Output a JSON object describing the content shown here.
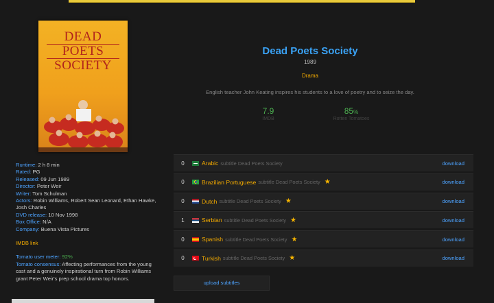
{
  "movie": {
    "title": "Dead Poets Society",
    "year": "1989",
    "genre": "Drama",
    "plot": "English teacher John Keating inspires his students to a love of poetry and to seize the day.",
    "poster_title_lines": [
      "DEAD",
      "POETS",
      "SOCIETY"
    ]
  },
  "scores": {
    "imdb": {
      "value": "7.9",
      "label": "IMDB"
    },
    "rt": {
      "value": "85",
      "unit": "%",
      "label": "Rotten Tomatoes"
    }
  },
  "info": {
    "runtime": {
      "key": "Runtime:",
      "value": "2 h 8 min"
    },
    "rated": {
      "key": "Rated:",
      "value": "PG"
    },
    "released": {
      "key": "Released:",
      "value": "09 Jun 1989"
    },
    "director": {
      "key": "Director:",
      "value": "Peter Weir"
    },
    "writer": {
      "key": "Writer:",
      "value": "Tom Schulman"
    },
    "actors": {
      "key": "Actors:",
      "value": "Robin Williams, Robert Sean Leonard, Ethan Hawke, Josh Charles"
    },
    "dvd": {
      "key": "DVD release:",
      "value": "10 Nov 1998"
    },
    "box_office": {
      "key": "Box Office:",
      "value": "N/A"
    },
    "company": {
      "key": "Company:",
      "value": "Buena Vista Pictures"
    },
    "imdb_link": "IMDB link",
    "tomato_meter": {
      "key": "Tomato user meter:",
      "value": "92%"
    },
    "tomato_consensus": {
      "key": "Tomato consensus:",
      "value": "Affecting performances from the young cast and a genuinely inspirational turn from Robin Williams grant Peter Weir's prep school drama top honors."
    }
  },
  "subtitles": [
    {
      "count": "0",
      "language": "Arabic",
      "text": "subtitle Dead Poets Society",
      "star": false,
      "flag": "saudi-arabia-flag-icon",
      "download": "download"
    },
    {
      "count": "0",
      "language": "Brazilian Portuguese",
      "text": "subtitle Dead Poets Society",
      "star": true,
      "flag": "brazil-flag-icon",
      "download": "download"
    },
    {
      "count": "0",
      "language": "Dutch",
      "text": "subtitle Dead Poets Society",
      "star": true,
      "flag": "netherlands-flag-icon",
      "download": "download"
    },
    {
      "count": "1",
      "language": "Serbian",
      "text": "subtitle Dead Poets Society",
      "star": true,
      "flag": "serbia-flag-icon",
      "download": "download"
    },
    {
      "count": "0",
      "language": "Spanish",
      "text": "subtitle Dead Poets Society",
      "star": true,
      "flag": "spain-flag-icon",
      "download": "download"
    },
    {
      "count": "0",
      "language": "Turkish",
      "text": "subtitle Dead Poets Society",
      "star": true,
      "flag": "turkey-flag-icon",
      "download": "download"
    }
  ],
  "star_glyph": "★",
  "upload_label": "upload subtitles",
  "colors": {
    "title": "#3aa2f5",
    "accent": "#f0a800",
    "score": "#4caf50",
    "link": "#4da3ff"
  }
}
